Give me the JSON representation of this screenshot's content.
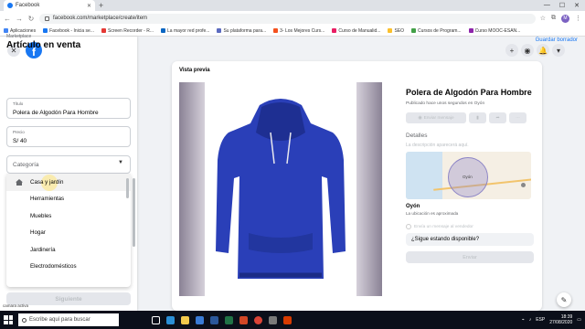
{
  "browser": {
    "tab_title": "Facebook",
    "url": "facebook.com/marketplace/create/item",
    "profile_initial": "M",
    "bookmarks": [
      "Aplicaciones",
      "Facebook - Inicia se...",
      "Screen Recorder - R...",
      "La mayor red profe...",
      "Su plataforma para...",
      "3- Los Mejores Curs...",
      "Curso de Manualid...",
      "SEO",
      "Cursos de Program...",
      "Curso MOOC-ESAN..."
    ]
  },
  "sidebar": {
    "breadcrumb": "Marketplace",
    "title": "Artículo en venta",
    "save_draft": "Guardar borrador",
    "title_field": {
      "label": "Título",
      "value": "Polera de Algodón Para Hombre"
    },
    "price_field": {
      "label": "Precio",
      "value": "S/ 40"
    },
    "category_field": {
      "label": "Categoría"
    },
    "category_options": [
      "Casa y jardín",
      "Herramientas",
      "Muebles",
      "Hogar",
      "Jardinería",
      "Electrodomésticos"
    ],
    "next_button": "Siguiente"
  },
  "preview": {
    "label": "Vista previa",
    "product_title": "Polera de Algodón Para Hombre",
    "published": "Publicado hace unos segundos en Oyón",
    "send_message": "Enviar mensaje",
    "details_heading": "Detalles",
    "description_placeholder": "La descripción aparecerá aquí.",
    "map_city": "Oyón",
    "location": "Oyón",
    "location_note": "La ubicación es aproximada",
    "seller_message": "Envía un mensaje al vendedor",
    "question": "¿Sigue estando disponible?",
    "send_button": "Enviar"
  },
  "taskbar": {
    "search_placeholder": "Escribe aquí para buscar",
    "lang": "ESP",
    "time": "18:39",
    "date": "27/08/2020"
  },
  "overlay": {
    "cursor_tip": "camara activa"
  },
  "colors": {
    "brand": "#1877f2",
    "hoodie": "#2a3fb8"
  }
}
